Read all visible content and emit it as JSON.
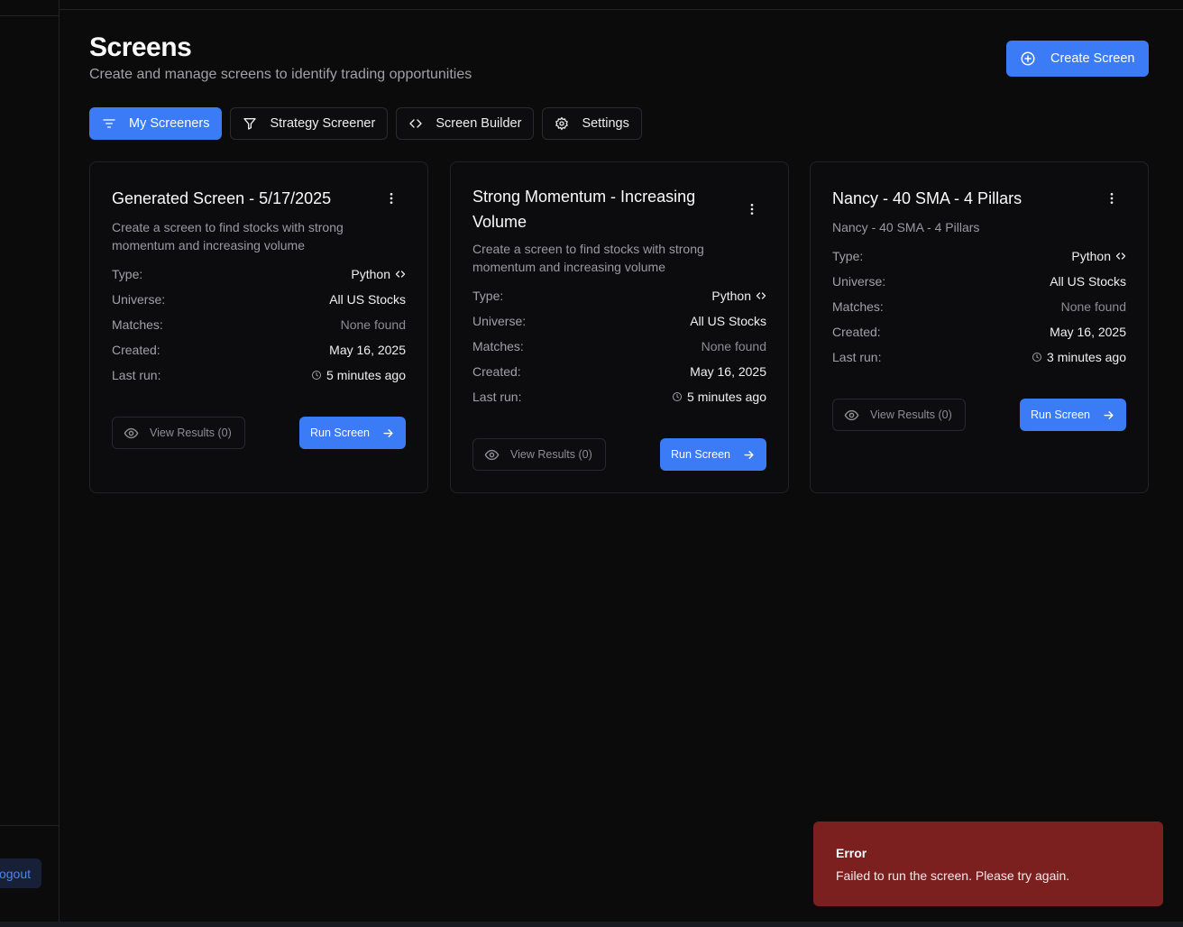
{
  "sidebar": {
    "logout_label": "Logout"
  },
  "header": {
    "title": "Screens",
    "subtitle": "Create and manage screens to identify trading opportunities",
    "create_label": "Create Screen"
  },
  "tabs": [
    {
      "label": "My Screeners",
      "icon": "filter-lines-icon",
      "active": true
    },
    {
      "label": "Strategy Screener",
      "icon": "funnel-icon",
      "active": false
    },
    {
      "label": "Screen Builder",
      "icon": "code-icon",
      "active": false
    },
    {
      "label": "Settings",
      "icon": "gear-icon",
      "active": false
    }
  ],
  "field_labels": {
    "type": "Type:",
    "universe": "Universe:",
    "matches": "Matches:",
    "created": "Created:",
    "last_run": "Last run:"
  },
  "cards": [
    {
      "title": "Generated Screen - 5/17/2025",
      "description": "Create a screen to find stocks with strong momentum and increasing volume",
      "type": "Python",
      "universe": "All US Stocks",
      "matches": "None found",
      "created": "May 16, 2025",
      "last_run": "5 minutes ago",
      "view_label": "View Results (0)",
      "run_label": "Run Screen"
    },
    {
      "title": "Strong Momentum - Increasing Volume",
      "description": "Create a screen to find stocks with strong momentum and increasing volume",
      "type": "Python",
      "universe": "All US Stocks",
      "matches": "None found",
      "created": "May 16, 2025",
      "last_run": "5 minutes ago",
      "view_label": "View Results (0)",
      "run_label": "Run Screen"
    },
    {
      "title": "Nancy - 40 SMA - 4 Pillars",
      "description": "Nancy - 40 SMA - 4 Pillars",
      "type": "Python",
      "universe": "All US Stocks",
      "matches": "None found",
      "created": "May 16, 2025",
      "last_run": "3 minutes ago",
      "view_label": "View Results (0)",
      "run_label": "Run Screen"
    }
  ],
  "toast": {
    "title": "Error",
    "message": "Failed to run the screen. Please try again."
  },
  "colors": {
    "accent": "#3b7cf6",
    "background": "#0b0b0c",
    "error": "#7b1f1f"
  }
}
